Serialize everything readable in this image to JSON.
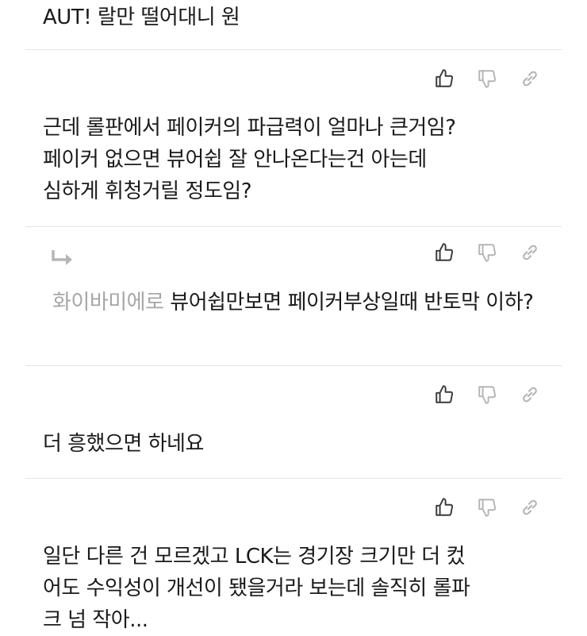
{
  "comments": [
    {
      "text": "AUT!    랄만 떨어대니 원"
    },
    {
      "text": "근데 롤판에서 페이커의 파급력이 얼마나 큰거임?\n페이커 없으면 뷰어쉽 잘 안나온다는건 아는데\n심하게 휘청거릴 정도임?"
    },
    {
      "mention": "화이바미에로",
      "text": " 뷰어쉽만보면 페이커부상일때 반토막 이하?"
    },
    {
      "text": "더 흥했으면 하네요"
    },
    {
      "text": "일단 다른 건 모르겠고 LCK는 경기장 크기만 더 컸\n어도 수익성이 개선이 됐을거라 보는데 솔직히 롤파\n크 넘 작아..."
    }
  ],
  "icons": {
    "like": "thumbs-up-icon",
    "dislike": "thumbs-down-icon",
    "link": "link-icon",
    "reply": "reply-arrow-icon"
  },
  "colors": {
    "text": "#1a1a1a",
    "mention": "#a6a6a6",
    "icon": "#3a3a3a",
    "icon_muted": "#b5b5b5",
    "divider": "#e4e4e4"
  }
}
